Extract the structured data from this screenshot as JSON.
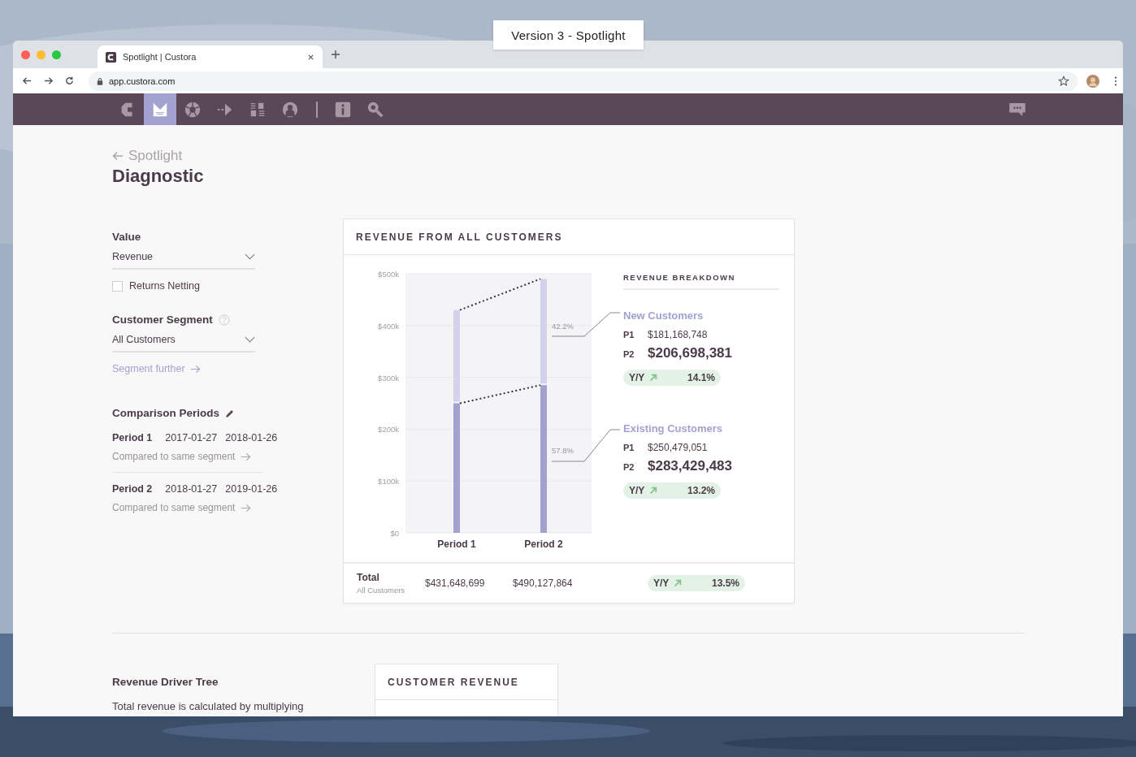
{
  "caption": "Version 3 - Spotlight",
  "browser": {
    "tab_title": "Spotlight | Custora",
    "url": "app.custora.com"
  },
  "nav": {
    "items": [
      {
        "selected": false
      },
      {
        "selected": true
      },
      {
        "selected": false
      },
      {
        "selected": false
      },
      {
        "selected": false
      },
      {
        "selected": false
      },
      {
        "selected": false
      },
      {
        "selected": false
      }
    ]
  },
  "header": {
    "back_label": "Spotlight",
    "title": "Diagnostic"
  },
  "filters": {
    "value_label": "Value",
    "value_select": "Revenue",
    "returns_netting": {
      "label": "Returns Netting",
      "checked": false
    },
    "segment_label": "Customer Segment",
    "segment_select": "All Customers",
    "segment_link": "Segment further"
  },
  "comparison": {
    "title": "Comparison Periods",
    "periods": [
      {
        "name": "Period 1",
        "start": "2017-01-27",
        "end": "2018-01-26",
        "note": "Compared to same segment"
      },
      {
        "name": "Period 2",
        "start": "2018-01-27",
        "end": "2019-01-26",
        "note": "Compared to same segment"
      }
    ]
  },
  "revenue_card": {
    "title": "REVENUE FROM ALL CUSTOMERS",
    "chart_data": {
      "type": "bar",
      "stacked": true,
      "grid": true,
      "categories": [
        "Period 1",
        "Period 2"
      ],
      "ylim": [
        0,
        500
      ],
      "yticks": [
        {
          "value": 0,
          "label": "$0"
        },
        {
          "value": 100,
          "label": "$100k"
        },
        {
          "value": 200,
          "label": "$200k"
        },
        {
          "value": 300,
          "label": "$300k"
        },
        {
          "value": 400,
          "label": "$400k"
        },
        {
          "value": 500,
          "label": "$500k"
        }
      ],
      "series": [
        {
          "name": "Existing Customers",
          "color": "#a3a1cf",
          "values": [
            250,
            285
          ]
        },
        {
          "name": "New Customers",
          "color": "#d3d2ea",
          "values": [
            180,
            205
          ]
        }
      ]
    },
    "breakdown": {
      "title": "REVENUE BREAKDOWN",
      "groups": [
        {
          "share": "42.2%",
          "p1_label": "P1",
          "p1": "$181,168,748",
          "p2_label": "P2",
          "p2": "$206,698,381",
          "yy_label": "Y/Y",
          "yy": "14.1%"
        },
        {
          "share": "57.8%",
          "p1_label": "P1",
          "p1": "$250,479,051",
          "p2_label": "P2",
          "p2": "$283,429,483",
          "yy_label": "Y/Y",
          "yy": "13.2%"
        }
      ]
    },
    "total": {
      "label": "Total",
      "sublabel": "All Customers",
      "p1": "$431,648,699",
      "p2": "$490,127,864",
      "yy_label": "Y/Y",
      "yy": "13.5%"
    }
  },
  "driver_tree": {
    "title": "Revenue Driver Tree",
    "text": "Total revenue is calculated by multiplying"
  },
  "customer_card": {
    "title": "CUSTOMER REVENUE"
  }
}
